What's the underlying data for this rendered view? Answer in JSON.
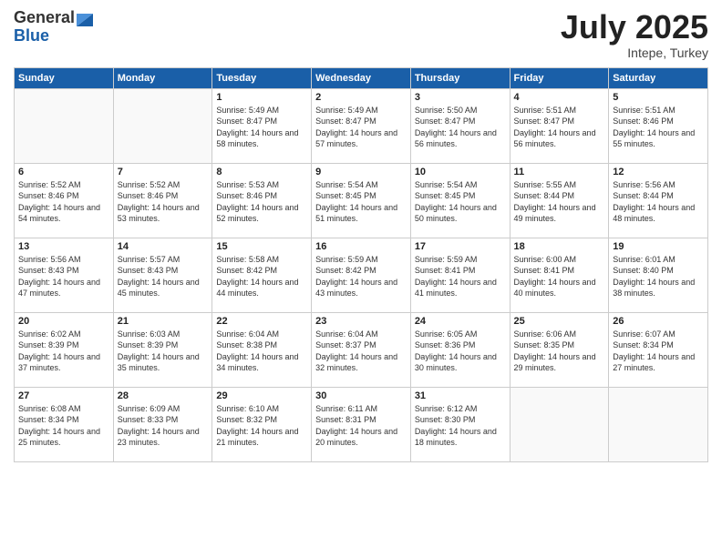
{
  "logo": {
    "general": "General",
    "blue": "Blue"
  },
  "header": {
    "month": "July 2025",
    "location": "Intepe, Turkey"
  },
  "weekdays": [
    "Sunday",
    "Monday",
    "Tuesday",
    "Wednesday",
    "Thursday",
    "Friday",
    "Saturday"
  ],
  "weeks": [
    [
      {
        "day": "",
        "sunrise": "",
        "sunset": "",
        "daylight": ""
      },
      {
        "day": "",
        "sunrise": "",
        "sunset": "",
        "daylight": ""
      },
      {
        "day": "1",
        "sunrise": "Sunrise: 5:49 AM",
        "sunset": "Sunset: 8:47 PM",
        "daylight": "Daylight: 14 hours and 58 minutes."
      },
      {
        "day": "2",
        "sunrise": "Sunrise: 5:49 AM",
        "sunset": "Sunset: 8:47 PM",
        "daylight": "Daylight: 14 hours and 57 minutes."
      },
      {
        "day": "3",
        "sunrise": "Sunrise: 5:50 AM",
        "sunset": "Sunset: 8:47 PM",
        "daylight": "Daylight: 14 hours and 56 minutes."
      },
      {
        "day": "4",
        "sunrise": "Sunrise: 5:51 AM",
        "sunset": "Sunset: 8:47 PM",
        "daylight": "Daylight: 14 hours and 56 minutes."
      },
      {
        "day": "5",
        "sunrise": "Sunrise: 5:51 AM",
        "sunset": "Sunset: 8:46 PM",
        "daylight": "Daylight: 14 hours and 55 minutes."
      }
    ],
    [
      {
        "day": "6",
        "sunrise": "Sunrise: 5:52 AM",
        "sunset": "Sunset: 8:46 PM",
        "daylight": "Daylight: 14 hours and 54 minutes."
      },
      {
        "day": "7",
        "sunrise": "Sunrise: 5:52 AM",
        "sunset": "Sunset: 8:46 PM",
        "daylight": "Daylight: 14 hours and 53 minutes."
      },
      {
        "day": "8",
        "sunrise": "Sunrise: 5:53 AM",
        "sunset": "Sunset: 8:46 PM",
        "daylight": "Daylight: 14 hours and 52 minutes."
      },
      {
        "day": "9",
        "sunrise": "Sunrise: 5:54 AM",
        "sunset": "Sunset: 8:45 PM",
        "daylight": "Daylight: 14 hours and 51 minutes."
      },
      {
        "day": "10",
        "sunrise": "Sunrise: 5:54 AM",
        "sunset": "Sunset: 8:45 PM",
        "daylight": "Daylight: 14 hours and 50 minutes."
      },
      {
        "day": "11",
        "sunrise": "Sunrise: 5:55 AM",
        "sunset": "Sunset: 8:44 PM",
        "daylight": "Daylight: 14 hours and 49 minutes."
      },
      {
        "day": "12",
        "sunrise": "Sunrise: 5:56 AM",
        "sunset": "Sunset: 8:44 PM",
        "daylight": "Daylight: 14 hours and 48 minutes."
      }
    ],
    [
      {
        "day": "13",
        "sunrise": "Sunrise: 5:56 AM",
        "sunset": "Sunset: 8:43 PM",
        "daylight": "Daylight: 14 hours and 47 minutes."
      },
      {
        "day": "14",
        "sunrise": "Sunrise: 5:57 AM",
        "sunset": "Sunset: 8:43 PM",
        "daylight": "Daylight: 14 hours and 45 minutes."
      },
      {
        "day": "15",
        "sunrise": "Sunrise: 5:58 AM",
        "sunset": "Sunset: 8:42 PM",
        "daylight": "Daylight: 14 hours and 44 minutes."
      },
      {
        "day": "16",
        "sunrise": "Sunrise: 5:59 AM",
        "sunset": "Sunset: 8:42 PM",
        "daylight": "Daylight: 14 hours and 43 minutes."
      },
      {
        "day": "17",
        "sunrise": "Sunrise: 5:59 AM",
        "sunset": "Sunset: 8:41 PM",
        "daylight": "Daylight: 14 hours and 41 minutes."
      },
      {
        "day": "18",
        "sunrise": "Sunrise: 6:00 AM",
        "sunset": "Sunset: 8:41 PM",
        "daylight": "Daylight: 14 hours and 40 minutes."
      },
      {
        "day": "19",
        "sunrise": "Sunrise: 6:01 AM",
        "sunset": "Sunset: 8:40 PM",
        "daylight": "Daylight: 14 hours and 38 minutes."
      }
    ],
    [
      {
        "day": "20",
        "sunrise": "Sunrise: 6:02 AM",
        "sunset": "Sunset: 8:39 PM",
        "daylight": "Daylight: 14 hours and 37 minutes."
      },
      {
        "day": "21",
        "sunrise": "Sunrise: 6:03 AM",
        "sunset": "Sunset: 8:39 PM",
        "daylight": "Daylight: 14 hours and 35 minutes."
      },
      {
        "day": "22",
        "sunrise": "Sunrise: 6:04 AM",
        "sunset": "Sunset: 8:38 PM",
        "daylight": "Daylight: 14 hours and 34 minutes."
      },
      {
        "day": "23",
        "sunrise": "Sunrise: 6:04 AM",
        "sunset": "Sunset: 8:37 PM",
        "daylight": "Daylight: 14 hours and 32 minutes."
      },
      {
        "day": "24",
        "sunrise": "Sunrise: 6:05 AM",
        "sunset": "Sunset: 8:36 PM",
        "daylight": "Daylight: 14 hours and 30 minutes."
      },
      {
        "day": "25",
        "sunrise": "Sunrise: 6:06 AM",
        "sunset": "Sunset: 8:35 PM",
        "daylight": "Daylight: 14 hours and 29 minutes."
      },
      {
        "day": "26",
        "sunrise": "Sunrise: 6:07 AM",
        "sunset": "Sunset: 8:34 PM",
        "daylight": "Daylight: 14 hours and 27 minutes."
      }
    ],
    [
      {
        "day": "27",
        "sunrise": "Sunrise: 6:08 AM",
        "sunset": "Sunset: 8:34 PM",
        "daylight": "Daylight: 14 hours and 25 minutes."
      },
      {
        "day": "28",
        "sunrise": "Sunrise: 6:09 AM",
        "sunset": "Sunset: 8:33 PM",
        "daylight": "Daylight: 14 hours and 23 minutes."
      },
      {
        "day": "29",
        "sunrise": "Sunrise: 6:10 AM",
        "sunset": "Sunset: 8:32 PM",
        "daylight": "Daylight: 14 hours and 21 minutes."
      },
      {
        "day": "30",
        "sunrise": "Sunrise: 6:11 AM",
        "sunset": "Sunset: 8:31 PM",
        "daylight": "Daylight: 14 hours and 20 minutes."
      },
      {
        "day": "31",
        "sunrise": "Sunrise: 6:12 AM",
        "sunset": "Sunset: 8:30 PM",
        "daylight": "Daylight: 14 hours and 18 minutes."
      },
      {
        "day": "",
        "sunrise": "",
        "sunset": "",
        "daylight": ""
      },
      {
        "day": "",
        "sunrise": "",
        "sunset": "",
        "daylight": ""
      }
    ]
  ]
}
